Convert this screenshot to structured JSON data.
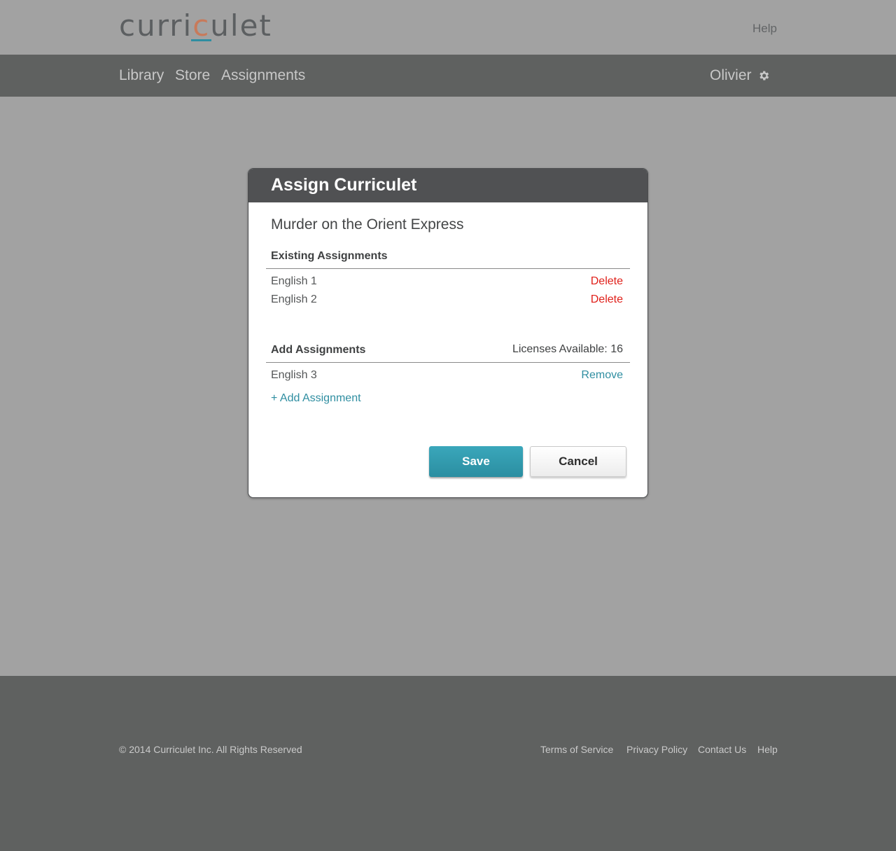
{
  "brand": {
    "logo_pre": "curri",
    "logo_accent": "c",
    "logo_post": "ulet"
  },
  "header": {
    "help": "Help"
  },
  "nav": {
    "items": [
      "Library",
      "Store",
      "Assignments"
    ],
    "user": "Olivier",
    "user_icon": "gear-icon"
  },
  "modal": {
    "title": "Assign Curriculet",
    "book_title": "Murder on the Orient Express",
    "existing": {
      "heading": "Existing Assignments",
      "rows": [
        {
          "label": "English 1",
          "action": "Delete"
        },
        {
          "label": "English 2",
          "action": "Delete"
        }
      ]
    },
    "add": {
      "heading": "Add Assignments",
      "licenses": "Licenses Available: 16",
      "rows": [
        {
          "label": "English 3",
          "action": "Remove"
        }
      ],
      "add_link": "+ Add Assignment"
    },
    "save_label": "Save",
    "cancel_label": "Cancel"
  },
  "footer": {
    "copyright": "© 2014 Curriculet Inc. All Rights Reserved",
    "links": [
      "Terms of Service",
      "Privacy Policy",
      "Contact Us",
      "Help"
    ]
  },
  "colors": {
    "accent_teal": "#2f8ea1",
    "delete_red": "#e0201a",
    "navbar": "#5f6160",
    "overlay": "#a2a2a2"
  }
}
